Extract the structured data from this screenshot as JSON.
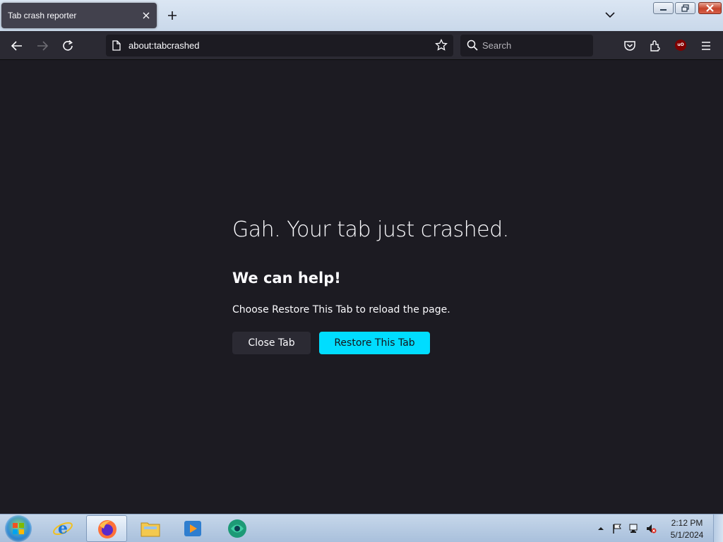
{
  "browser": {
    "tab": {
      "title": "Tab crash reporter"
    },
    "url": "about:tabcrashed",
    "search_placeholder": "Search",
    "ublock_badge": "uO"
  },
  "crash_page": {
    "title": "Gah. Your tab just crashed.",
    "subtitle": "We can help!",
    "body": "Choose Restore This Tab to reload the page.",
    "close_tab_label": "Close Tab",
    "restore_tab_label": "Restore This Tab",
    "accent_color": "#00ddff"
  },
  "taskbar": {
    "pinned": [
      "internet-explorer-icon",
      "firefox-icon",
      "file-explorer-icon",
      "media-player-icon",
      "app-icon"
    ],
    "active": "firefox-icon",
    "clock": {
      "time": "2:12 PM",
      "date": "5/1/2024"
    }
  }
}
